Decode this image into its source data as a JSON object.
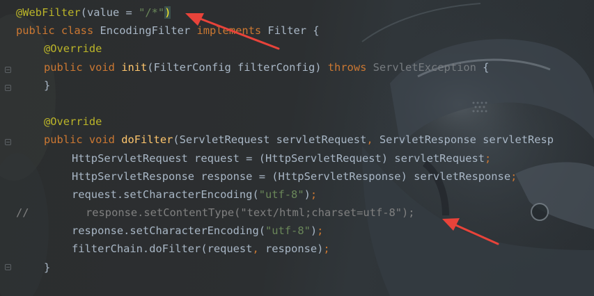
{
  "editor": {
    "theme_colors": {
      "keyword": "#cc7832",
      "annotation": "#bbb529",
      "string": "#6a8759",
      "text": "#a9b7c6",
      "method": "#ffc66d",
      "comment": "#808080",
      "arrow": "#e8433a"
    },
    "code": {
      "l1_annotation": "@WebFilter",
      "l1_open": "(",
      "l1_value": "value = ",
      "l1_string": "\"/*\"",
      "l1_close": ")",
      "l2_public": "public ",
      "l2_class": "class ",
      "l2_name": "EncodingFilter ",
      "l2_implements": "implements ",
      "l2_iface": "Filter {",
      "l3_override": "@Override",
      "l4_public": "public ",
      "l4_void": "void ",
      "l4_method": "init",
      "l4_params": "(FilterConfig filterConfig) ",
      "l4_throws": "throws ",
      "l4_exception": "ServletException",
      "l4_brace": " {",
      "l5_close": "}",
      "l6_override": "@Override",
      "l7_public": "public ",
      "l7_void": "void ",
      "l7_method": "doFilter",
      "l7_params_a": "(ServletRequest servletRequest",
      "l7_comma": ", ",
      "l7_params_b": "ServletResponse servletResp",
      "l8_text": "HttpServletRequest request = (HttpServletRequest) servletRequest",
      "l8_semi": ";",
      "l9_text": "HttpServletResponse response = (HttpServletResponse) servletResponse",
      "l9_semi": ";",
      "l10_call": "request.setCharacterEncoding(",
      "l10_string": "\"utf-8\"",
      "l10_end": ")",
      "l10_semi": ";",
      "l11_slashes": "//",
      "l11_text": "response.setContentType(\"text/html;charset=utf-8\");",
      "l12_call": "response.setCharacterEncoding(",
      "l12_string": "\"utf-8\"",
      "l12_end": ")",
      "l12_semi": ";",
      "l13_text": "filterChain.doFilter(request",
      "l13_comma": ", ",
      "l13_end": "response)",
      "l13_semi": ";",
      "l14_close": "}"
    }
  }
}
